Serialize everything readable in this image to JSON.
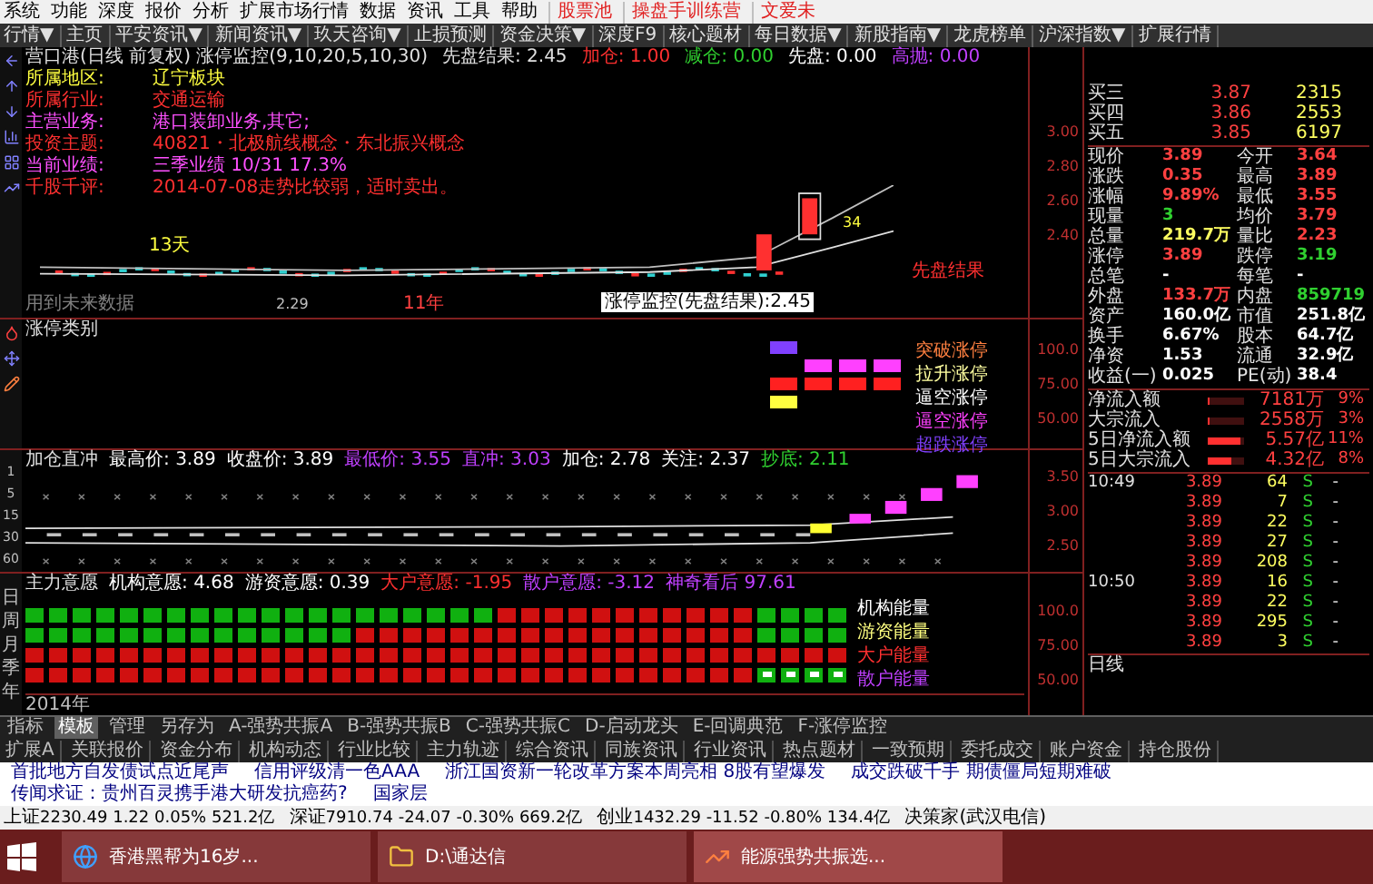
{
  "menu": [
    "系统",
    "功能",
    "深度",
    "报价",
    "分析",
    "扩展市场行情",
    "数据",
    "资讯",
    "工具",
    "帮助"
  ],
  "menu_tags": [
    "股票池",
    "操盘手训练营",
    "文爱未"
  ],
  "toolbar": [
    "行情▼",
    "主页",
    "平安资讯▼",
    "新闻资讯▼",
    "玖天咨询▼",
    "止损预测",
    "资金决策▼",
    "深度F9",
    "核心题材",
    "每日数据▼",
    "新股指南▼",
    "龙虎榜单",
    "沪深指数▼",
    "扩展行情"
  ],
  "chart": {
    "title": "营口港(日线 前复权) 涨停监控(9,10,20,5,10,30)",
    "result": "先盘结果: 2.45",
    "signals": [
      {
        "label": "加仓:",
        "value": "1.00",
        "color": "#ff3030"
      },
      {
        "label": "减仓:",
        "value": "0.00",
        "color": "#30d030"
      },
      {
        "label": "先盘:",
        "value": "0.00",
        "color": "#ffffff"
      },
      {
        "label": "高抛:",
        "value": "0.00",
        "color": "#c040ff"
      }
    ],
    "info": [
      {
        "label": "所属地区:",
        "value": "辽宁板块",
        "color": "#ffff40"
      },
      {
        "label": "所属行业:",
        "value": "交通运输",
        "color": "#ff3030"
      },
      {
        "label": "主营业务:",
        "value": "港口装卸业务,其它;",
        "color": "#ff50ff"
      },
      {
        "label": "投资主题:",
        "value": "40821・北极航线概念・东北振兴概念",
        "color": "#ff3030"
      },
      {
        "label": "当前业绩:",
        "value": "三季业绩 10/31 17.3%",
        "color": "#ff50ff"
      },
      {
        "label": "千股千评:",
        "value": "2014-07-08走势比较弱，适时卖出。",
        "color": "#ff3030"
      }
    ],
    "labels": {
      "days": "13天",
      "low": "2.29",
      "year": "11年",
      "future": "用到未来数据",
      "count": "34",
      "result_tag": "先盘结果",
      "tooltip": "涨停监控(先盘结果):2.45"
    },
    "axis": [
      "3.00",
      "2.80",
      "2.60",
      "2.40"
    ]
  },
  "limit_panel": {
    "title": "涨停类别",
    "axis": [
      "100.0",
      "75.00",
      "50.00"
    ],
    "legend": [
      {
        "label": "突破涨停",
        "color": "#ff8040"
      },
      {
        "label": "拉升涨停",
        "color": "#ffffa0"
      },
      {
        "label": "逼空涨停",
        "color": "#ffffff"
      },
      {
        "label": "逼空涨停",
        "color": "#ff40ff"
      },
      {
        "label": "超跌涨停",
        "color": "#8040ff"
      }
    ]
  },
  "add_panel": {
    "title": "加仓直冲",
    "axis": [
      "3.50",
      "3.00",
      "2.50"
    ],
    "periods": [
      "1",
      "5",
      "15",
      "30",
      "60"
    ],
    "items": [
      {
        "label": "最高价:",
        "value": "3.89",
        "color": "#ffffff"
      },
      {
        "label": "收盘价:",
        "value": "3.89",
        "color": "#ffffff"
      },
      {
        "label": "最低价:",
        "value": "3.55",
        "color": "#c040ff"
      },
      {
        "label": "直冲:",
        "value": "3.03",
        "color": "#c040ff"
      },
      {
        "label": "加仓:",
        "value": "2.78",
        "color": "#ffffff"
      },
      {
        "label": "关注:",
        "value": "2.37",
        "color": "#ffffff"
      },
      {
        "label": "抄底:",
        "value": "2.11",
        "color": "#30d030"
      }
    ]
  },
  "will_panel": {
    "title": "主力意愿",
    "axis": [
      "100.0",
      "75.00",
      "50.00"
    ],
    "periods": [
      "日",
      "周",
      "月",
      "季",
      "年"
    ],
    "items": [
      {
        "label": "机构意愿:",
        "value": "4.68",
        "color": "#ffffff"
      },
      {
        "label": "游资意愿:",
        "value": "0.39",
        "color": "#ffffff"
      },
      {
        "label": "大户意愿:",
        "value": "-1.95",
        "color": "#ff3030"
      },
      {
        "label": "散户意愿:",
        "value": "-3.12",
        "color": "#c040ff"
      },
      {
        "label": "神奇看后",
        "value": "97.61",
        "color": "#c040ff"
      }
    ],
    "legend": [
      {
        "label": "机构能量",
        "color": "#ffffff"
      },
      {
        "label": "游资能量",
        "color": "#ffff80"
      },
      {
        "label": "大户能量",
        "color": "#ff3030"
      },
      {
        "label": "散户能量",
        "color": "#c040ff"
      }
    ],
    "year": "2014年"
  },
  "quote": {
    "bids": [
      {
        "name": "买三",
        "price": "3.87",
        "volume": "2315"
      },
      {
        "name": "买四",
        "price": "3.86",
        "volume": "2553"
      },
      {
        "name": "买五",
        "price": "3.85",
        "volume": "6197"
      }
    ],
    "stats": [
      {
        "label": "现价",
        "value": "3.89",
        "color": "#ff4040"
      },
      {
        "label": "今开",
        "value": "3.64",
        "color": "#ff4040"
      },
      {
        "label": "涨跌",
        "value": "0.35",
        "color": "#ff4040"
      },
      {
        "label": "最高",
        "value": "3.89",
        "color": "#ff4040"
      },
      {
        "label": "涨幅",
        "value": "9.89%",
        "color": "#ff4040"
      },
      {
        "label": "最低",
        "value": "3.55",
        "color": "#ff4040"
      },
      {
        "label": "现量",
        "value": "3",
        "color": "#30d030"
      },
      {
        "label": "均价",
        "value": "3.79",
        "color": "#ff4040"
      },
      {
        "label": "总量",
        "value": "219.7万",
        "color": "#ffff60"
      },
      {
        "label": "量比",
        "value": "2.23",
        "color": "#ff4040"
      },
      {
        "label": "涨停",
        "value": "3.89",
        "color": "#ff4040"
      },
      {
        "label": "跌停",
        "value": "3.19",
        "color": "#30d030"
      },
      {
        "label": "总笔",
        "value": "-",
        "color": "#ffffff"
      },
      {
        "label": "每笔",
        "value": "-",
        "color": "#ffffff"
      },
      {
        "label": "外盘",
        "value": "133.7万",
        "color": "#ff4040"
      },
      {
        "label": "内盘",
        "value": "859719",
        "color": "#30d030"
      },
      {
        "label": "资产",
        "value": "160.0亿",
        "color": "#ffffff"
      },
      {
        "label": "市值",
        "value": "251.8亿",
        "color": "#ffffff"
      },
      {
        "label": "换手",
        "value": "6.67%",
        "color": "#ffffff"
      },
      {
        "label": "股本",
        "value": "64.7亿",
        "color": "#ffffff"
      },
      {
        "label": "净资",
        "value": "1.53",
        "color": "#ffffff"
      },
      {
        "label": "流通",
        "value": "32.9亿",
        "color": "#ffffff"
      },
      {
        "label": "收益(一)",
        "value": "0.025",
        "color": "#ffffff"
      },
      {
        "label": "PE(动)",
        "value": "38.4",
        "color": "#ffffff"
      }
    ],
    "flows": [
      {
        "label": "净流入额",
        "value": "7181万",
        "pct": "9%",
        "level": 0.05
      },
      {
        "label": "大宗流入",
        "value": "2558万",
        "pct": "3%",
        "level": 0.03
      },
      {
        "label": "5日净流入额",
        "value": "5.57亿",
        "pct": "11%",
        "level": 0.9
      },
      {
        "label": "5日大宗流入",
        "value": "4.32亿",
        "pct": "8%",
        "level": 0.65
      }
    ],
    "ticks": [
      {
        "time": "10:49",
        "price": "3.89",
        "volume": "64",
        "side": "S",
        "mark": "-"
      },
      {
        "price": "3.89",
        "volume": "7",
        "side": "S",
        "mark": "-"
      },
      {
        "price": "3.89",
        "volume": "22",
        "side": "S",
        "mark": "-"
      },
      {
        "price": "3.89",
        "volume": "27",
        "side": "S",
        "mark": "-"
      },
      {
        "price": "3.89",
        "volume": "208",
        "side": "S",
        "mark": "-"
      },
      {
        "time": "10:50",
        "price": "3.89",
        "volume": "16",
        "side": "S",
        "mark": "-"
      },
      {
        "price": "3.89",
        "volume": "22",
        "side": "S",
        "mark": "-"
      },
      {
        "price": "3.89",
        "volume": "295",
        "side": "S",
        "mark": "-"
      },
      {
        "price": "3.89",
        "volume": "3",
        "side": "S",
        "mark": "-"
      }
    ],
    "period": "日线"
  },
  "tabs": [
    {
      "label": "指标",
      "selected": false
    },
    {
      "label": "模板",
      "selected": true
    },
    {
      "label": "管理",
      "selected": false
    },
    {
      "label": "另存为",
      "selected": false
    },
    {
      "label": "A-强势共振A",
      "selected": false
    },
    {
      "label": "B-强势共振B",
      "selected": false
    },
    {
      "label": "C-强势共振C",
      "selected": false
    },
    {
      "label": "D-启动龙头",
      "selected": false
    },
    {
      "label": "E-回调典范",
      "selected": false
    },
    {
      "label": "F-涨停监控",
      "selected": false
    }
  ],
  "tabs2": [
    "扩展A",
    "关联报价",
    "资金分布",
    "机构动态",
    "行业比较",
    "主力轨迹",
    "综合资讯",
    "同族资讯",
    "行业资讯",
    "热点题材",
    "一致预期",
    "委托成交",
    "账户资金",
    "持仓股份"
  ],
  "ticker": [
    "首批地方自发债试点近尾声",
    "信用评级清一色AAA",
    "浙江国资新一轮改革方案本周亮相 8股有望爆发",
    "成交跌破千手 期债僵局短期难破",
    "传闻求证：贵州百灵携手港大研发抗癌药?",
    "国家层"
  ],
  "status": {
    "indices": [
      {
        "name": "上证",
        "value": "2230.49",
        "change": "1.22",
        "pct": "0.05%",
        "amount": "521.2亿"
      },
      {
        "name": "深证",
        "value": "7910.74",
        "change": "-24.07",
        "pct": "-0.30%",
        "amount": "669.2亿"
      },
      {
        "name": "创业",
        "value": "1432.29",
        "change": "-11.52",
        "pct": "-0.80%",
        "amount": "134.4亿"
      }
    ],
    "server": "决策家(武汉电信)"
  },
  "taskbar": [
    {
      "kind": "browser",
      "label": "香港黑帮为16岁...",
      "selected": false
    },
    {
      "kind": "folder",
      "label": "D:\\通达信",
      "selected": false
    },
    {
      "kind": "app",
      "label": "能源强势共振选...",
      "selected": true
    }
  ]
}
